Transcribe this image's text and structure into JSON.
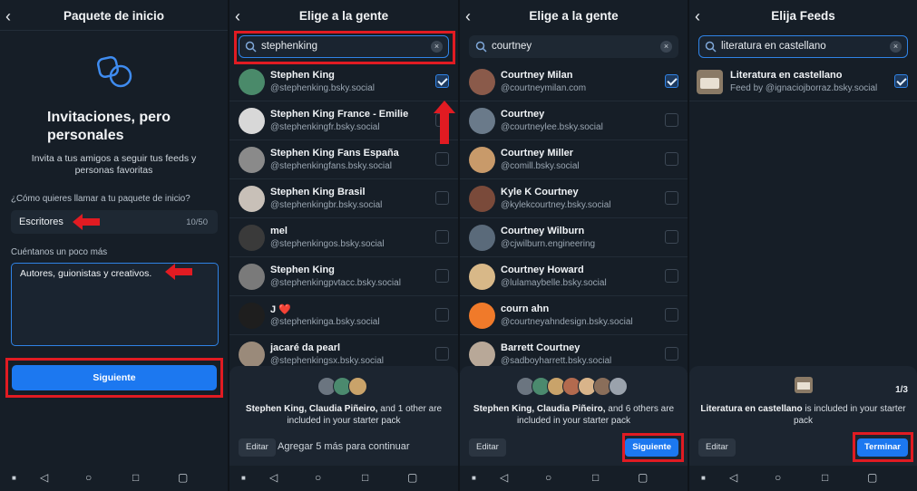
{
  "panel1": {
    "title": "Paquete de inicio",
    "heading": "Invitaciones, pero personales",
    "subtitle": "Invita a tus amigos a seguir tus feeds y personas favoritas",
    "name_label": "¿Cómo quieres llamar a tu paquete de inicio?",
    "name_value": "Escritores",
    "name_counter": "10/50",
    "desc_label": "Cuéntanos un poco más",
    "desc_value": "Autores, guionistas y creativos.",
    "next_button": "Siguiente"
  },
  "panel2": {
    "title": "Elige a la gente",
    "search_value": "stephenking",
    "people": [
      {
        "name": "Stephen King",
        "handle": "@stephenking.bsky.social",
        "checked": true
      },
      {
        "name": "Stephen King France - Emilie",
        "handle": "@stephenkingfr.bsky.social",
        "checked": false
      },
      {
        "name": "Stephen King Fans España",
        "handle": "@stephenkingfans.bsky.social",
        "checked": false
      },
      {
        "name": "Stephen King Brasil",
        "handle": "@stephenkingbr.bsky.social",
        "checked": false
      },
      {
        "name": "mel",
        "handle": "@stephenkingos.bsky.social",
        "checked": false
      },
      {
        "name": "Stephen King",
        "handle": "@stephenkingpvtacc.bsky.social",
        "checked": false
      },
      {
        "name": "J ❤️",
        "handle": "@stephenkinga.bsky.social",
        "checked": false
      },
      {
        "name": "jacaré da pearl",
        "handle": "@stephenkingsx.bsky.social",
        "checked": false
      }
    ],
    "sheet_bold": "Stephen King, Claudia Piñeiro,",
    "sheet_text": " and 1 other are included in your starter pack",
    "edit_button": "Editar",
    "add_message": "Agregar 5 más para continuar"
  },
  "panel3": {
    "title": "Elige a la gente",
    "search_value": "courtney",
    "people": [
      {
        "name": "Courtney Milan",
        "handle": "@courtneymilan.com",
        "checked": true
      },
      {
        "name": "Courtney",
        "handle": "@courtneylee.bsky.social",
        "checked": false
      },
      {
        "name": "Courtney Miller",
        "handle": "@comill.bsky.social",
        "checked": false
      },
      {
        "name": "Kyle K Courtney",
        "handle": "@kylekcourtney.bsky.social",
        "checked": false
      },
      {
        "name": "Courtney Wilburn",
        "handle": "@cjwilburn.engineering",
        "checked": false
      },
      {
        "name": "Courtney Howard",
        "handle": "@lulamaybelle.bsky.social",
        "checked": false
      },
      {
        "name": "courn ahn",
        "handle": "@courtneyahndesign.bsky.social",
        "checked": false
      },
      {
        "name": "Barrett Courtney",
        "handle": "@sadboyharrett.bsky.social",
        "checked": false
      }
    ],
    "sheet_bold": "Stephen King, Claudia Piñeiro,",
    "sheet_text": " and 6 others are included in your starter pack",
    "edit_button": "Editar",
    "next_button": "Siguiente"
  },
  "panel4": {
    "title": "Elija Feeds",
    "search_value": "literatura en castellano",
    "feeds": [
      {
        "name": "Literatura en castellano",
        "by": "Feed by @ignaciojborraz.bsky.social",
        "checked": true
      }
    ],
    "sheet_bold": "Literatura en castellano",
    "sheet_text": " is included in your starter pack",
    "page_indicator": "1/3",
    "edit_button": "Editar",
    "finish_button": "Terminar"
  },
  "colors": {
    "accent": "#1c78f0",
    "highlight": "#e11b22",
    "background": "#161e27"
  },
  "icons": [
    "back-arrow-icon",
    "search-icon",
    "clear-icon",
    "starter-pack-icon",
    "checkbox-icon",
    "nav-back-icon",
    "nav-home-icon",
    "nav-recents-icon",
    "nav-square-icon",
    "nav-dot-icon"
  ]
}
